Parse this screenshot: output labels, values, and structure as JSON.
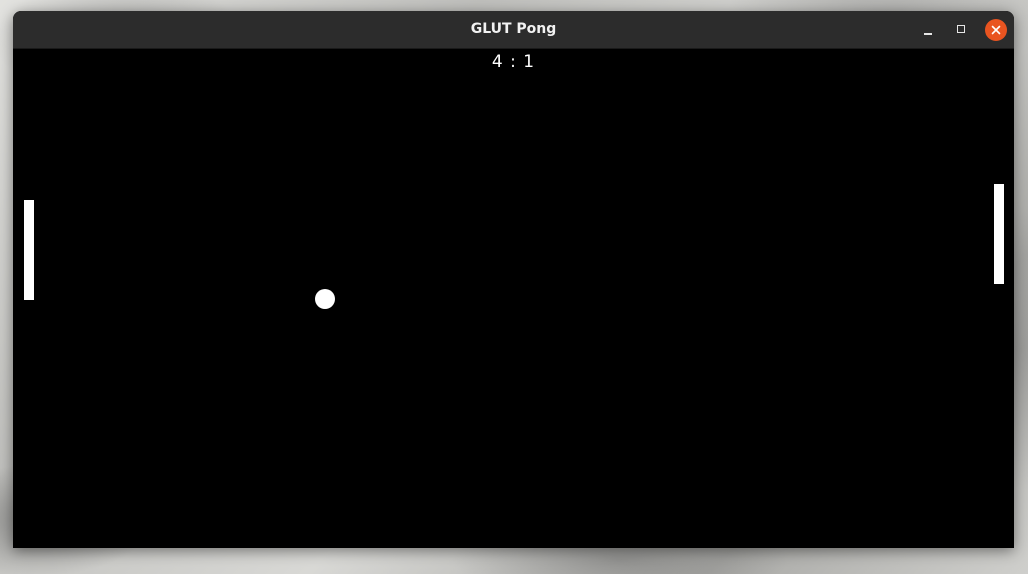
{
  "window": {
    "title": "GLUT Pong",
    "controls": {
      "minimize_icon": "minimize-icon",
      "maximize_icon": "maximize-icon",
      "close_icon": "close-icon"
    }
  },
  "game": {
    "score": "4 : 1",
    "colors": {
      "background": "#000000",
      "foreground": "#ffffff"
    }
  },
  "theme": {
    "titlebar": "#2c2c2c",
    "close_button": "#e95420"
  }
}
